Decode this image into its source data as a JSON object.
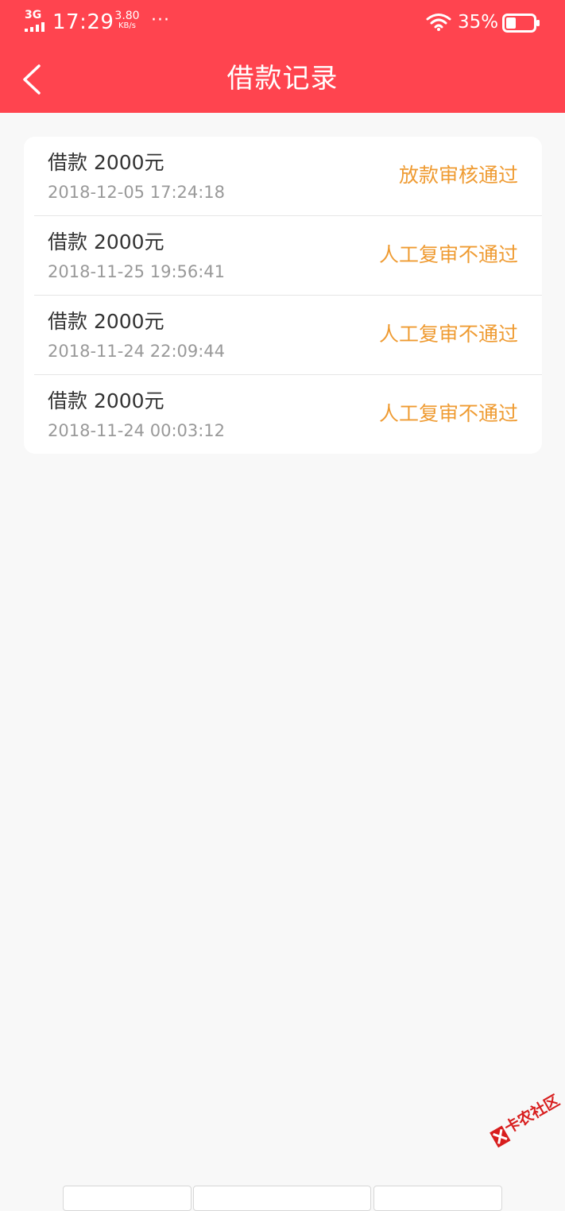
{
  "status_bar": {
    "network": "3G",
    "time": "17:29",
    "speed_value": "3.80",
    "speed_unit": "KB/s",
    "more": "···",
    "battery_percent": "35%",
    "battery_level": 0.35
  },
  "nav": {
    "title": "借款记录"
  },
  "records": [
    {
      "amount": "借款 2000元",
      "time": "2018-12-05 17:24:18",
      "status": "放款审核通过"
    },
    {
      "amount": "借款 2000元",
      "time": "2018-11-25 19:56:41",
      "status": "人工复审不通过"
    },
    {
      "amount": "借款 2000元",
      "time": "2018-11-24 22:09:44",
      "status": "人工复审不通过"
    },
    {
      "amount": "借款 2000元",
      "time": "2018-11-24 00:03:12",
      "status": "人工复审不通过"
    }
  ],
  "watermark": {
    "text": "卡农社区"
  },
  "colors": {
    "header": "#ff444f",
    "page_background": "#f8f8f8",
    "status_text": "#ef9b32",
    "primary_text": "#333333",
    "secondary_text": "#999999"
  }
}
